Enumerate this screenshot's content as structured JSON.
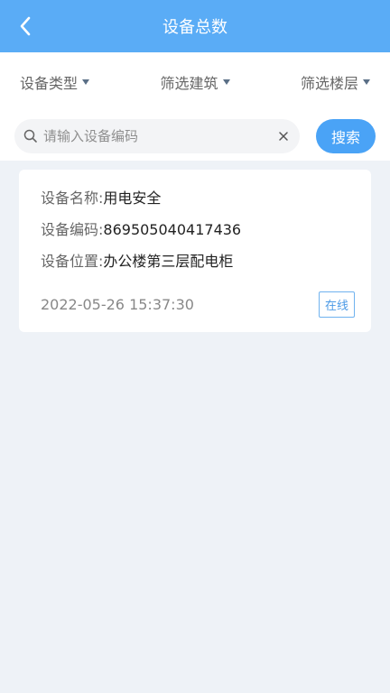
{
  "header": {
    "title": "设备总数"
  },
  "filters": [
    {
      "label": "设备类型"
    },
    {
      "label": "筛选建筑"
    },
    {
      "label": "筛选楼层"
    }
  ],
  "search": {
    "placeholder": "请输入设备编码",
    "value": "",
    "button_label": "搜索"
  },
  "devices": [
    {
      "name_label": "设备名称: ",
      "name": "用电安全",
      "code_label": "设备编码: ",
      "code": "869505040417436",
      "location_label": "设备位置: ",
      "location": "办公楼第三层配电柜",
      "time": "2022-05-26 15:37:30",
      "status": "在线"
    }
  ],
  "colors": {
    "header_bg": "#5aacf6",
    "accent": "#4aa3f6",
    "page_bg": "#eef2f7"
  }
}
